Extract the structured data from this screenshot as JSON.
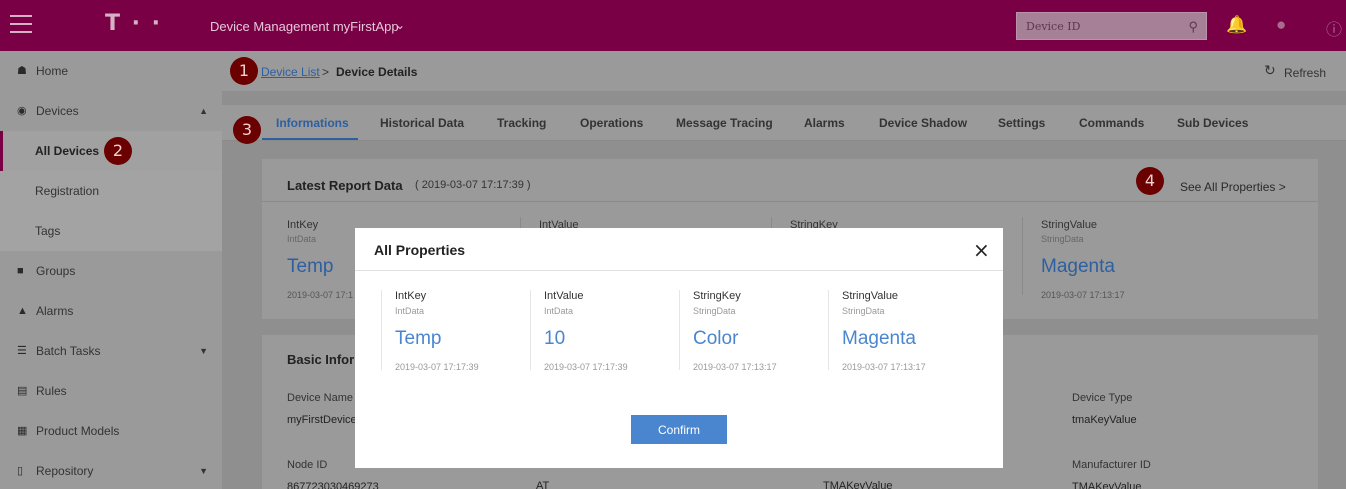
{
  "header": {
    "logo": "T · ·",
    "app_title": "Device Management  myFirstApp",
    "search_placeholder": "Device ID"
  },
  "sidebar": {
    "items": [
      {
        "label": "Home",
        "icon": "home-icon"
      },
      {
        "label": "Devices",
        "icon": "devices-icon"
      },
      {
        "label": "All Devices"
      },
      {
        "label": "Registration"
      },
      {
        "label": "Tags"
      },
      {
        "label": "Groups",
        "icon": "folder-icon"
      },
      {
        "label": "Alarms",
        "icon": "bell-icon"
      },
      {
        "label": "Batch Tasks",
        "icon": "list-icon"
      },
      {
        "label": "Rules",
        "icon": "document-icon"
      },
      {
        "label": "Product Models",
        "icon": "grid-icon"
      },
      {
        "label": "Repository",
        "icon": "repository-icon"
      }
    ]
  },
  "breadcrumb": {
    "link": "Device List",
    "sep": ">",
    "current": "Device Details",
    "refresh": "Refresh"
  },
  "tabs": [
    "Informations",
    "Historical Data",
    "Tracking",
    "Operations",
    "Message Tracing",
    "Alarms",
    "Device Shadow",
    "Settings",
    "Commands",
    "Sub Devices"
  ],
  "latest": {
    "title": "Latest Report Data",
    "time": "( 2019-03-07 17:17:39 )",
    "see_all": "See All Properties >",
    "props": [
      {
        "key": "IntKey",
        "service": "IntData",
        "value": "Temp",
        "time": "2019-03-07 17:1"
      },
      {
        "key": "IntValue"
      },
      {
        "key": "StringKey"
      },
      {
        "key": "StringValue",
        "service": "StringData",
        "value": "Magenta",
        "time": "2019-03-07 17:13:17"
      }
    ]
  },
  "basic": {
    "title": "Basic Infor",
    "fields": [
      {
        "label": "Device Name",
        "value": "myFirstDevice"
      },
      {
        "label": "Device Type",
        "value": "tmaKeyValue"
      },
      {
        "label": "Node ID",
        "value": "867723030469273"
      },
      {
        "value": "AT"
      },
      {
        "value": "TMAKeyValue"
      },
      {
        "label": "Manufacturer ID",
        "value": "TMAKeyValue"
      }
    ]
  },
  "markers": [
    "1",
    "2",
    "3",
    "4"
  ],
  "modal": {
    "title": "All Properties",
    "close": "×",
    "props": [
      {
        "key": "IntKey",
        "service": "IntData",
        "value": "Temp",
        "time": "2019-03-07 17:17:39"
      },
      {
        "key": "IntValue",
        "service": "IntData",
        "value": "10",
        "time": "2019-03-07 17:17:39"
      },
      {
        "key": "StringKey",
        "service": "StringData",
        "value": "Color",
        "time": "2019-03-07 17:13:17"
      },
      {
        "key": "StringValue",
        "service": "StringData",
        "value": "Magenta",
        "time": "2019-03-07 17:13:17"
      }
    ],
    "confirm": "Confirm"
  }
}
